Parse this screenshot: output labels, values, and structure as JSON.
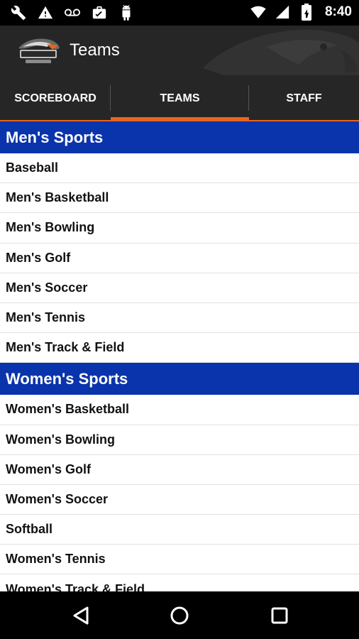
{
  "status_bar": {
    "time": "8:40",
    "left_icons": [
      "wrench-icon",
      "warning-icon",
      "voicemail-icon",
      "briefcase-icon",
      "android-icon"
    ],
    "right_icons": [
      "wifi-icon",
      "cell-signal-icon",
      "battery-icon"
    ]
  },
  "app_bar": {
    "title": "Teams"
  },
  "tabs": [
    {
      "label": "SCOREBOARD",
      "selected": false
    },
    {
      "label": "TEAMS",
      "selected": true
    },
    {
      "label": "STAFF",
      "selected": false
    }
  ],
  "sections": [
    {
      "header": "Men's Sports",
      "items": [
        "Baseball",
        "Men's Basketball",
        "Men's Bowling",
        "Men's Golf",
        "Men's Soccer",
        "Men's Tennis",
        "Men's Track & Field"
      ]
    },
    {
      "header": "Women's Sports",
      "items": [
        "Women's Basketball",
        "Women's Bowling",
        "Women's Golf",
        "Women's Soccer",
        "Softball",
        "Women's Tennis",
        "Women's Track & Field"
      ]
    }
  ],
  "nav_bar": {
    "buttons": [
      "back-icon",
      "home-icon",
      "recents-icon"
    ]
  },
  "colors": {
    "accent": "#e8641e",
    "section_header": "#0a34ab",
    "app_bar": "#262626"
  }
}
